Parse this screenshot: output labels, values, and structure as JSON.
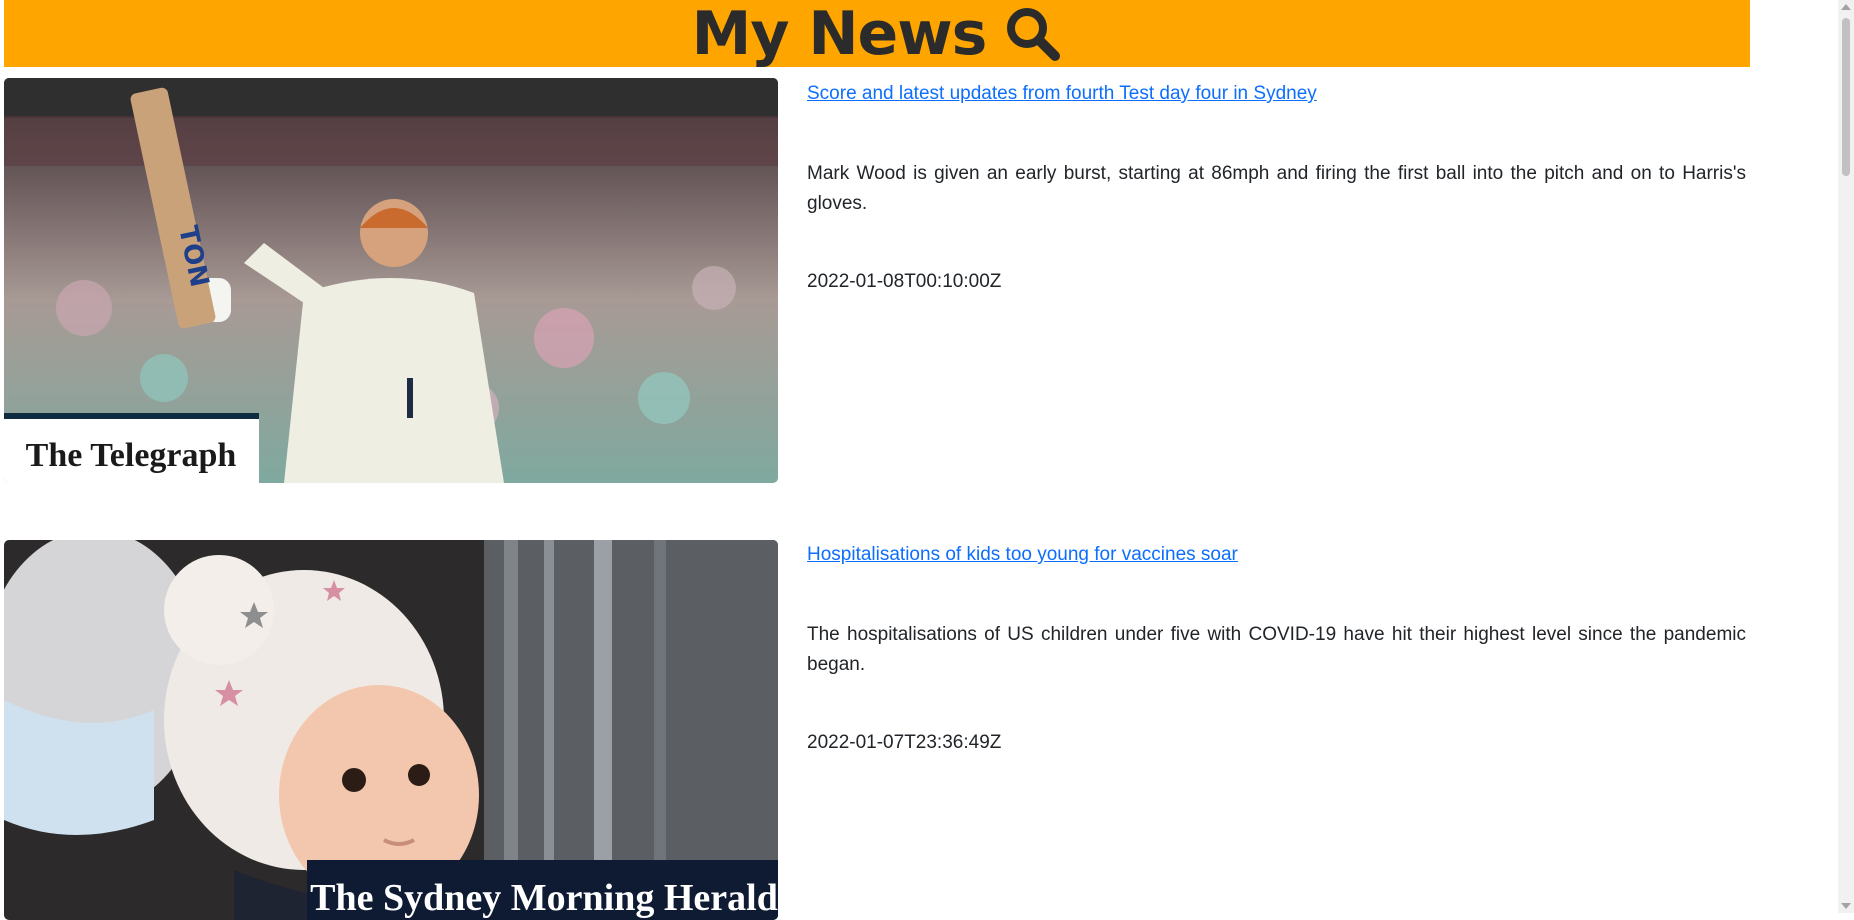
{
  "header": {
    "title": "My News",
    "icon": "search-icon",
    "background": "#FFA500"
  },
  "articles": [
    {
      "headline": "Score and latest updates from fourth Test day four in Sydney",
      "summary": "Mark Wood is given an early burst, starting at 86mph and firing the first ball into the pitch and on to Harris's gloves.",
      "published": "2022-01-08T00:10:00Z",
      "image_source_logo": "The Telegraph"
    },
    {
      "headline": "Hospitalisations of kids too young for vaccines soar",
      "summary": "The hospitalisations of US children under five with COVID-19 have hit their highest level since the pandemic began.",
      "published": "2022-01-07T23:36:49Z",
      "image_source_logo": "The Sydney Morning Herald"
    }
  ],
  "colors": {
    "link": "#0d6efd",
    "text": "#212529"
  }
}
